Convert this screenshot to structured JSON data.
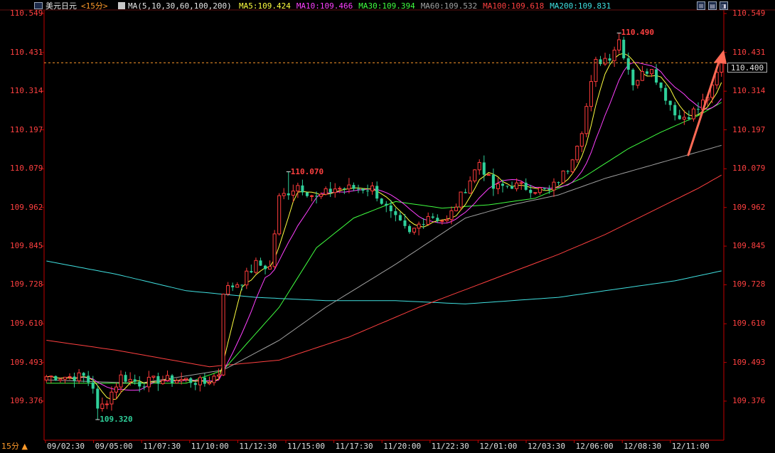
{
  "header": {
    "symbol": "美元日元",
    "period_tag": "<15分>",
    "ma_params": "MA(5,10,30,60,100,200)",
    "ma_items": [
      {
        "label": "MA5:109.424",
        "color": "#ffff40"
      },
      {
        "label": "MA10:109.466",
        "color": "#ff40ff"
      },
      {
        "label": "MA30:109.394",
        "color": "#40ff40"
      },
      {
        "label": "MA60:109.532",
        "color": "#a0a0a0"
      },
      {
        "label": "MA100:109.618",
        "color": "#ff4040"
      },
      {
        "label": "MA200:109.831",
        "color": "#40e0e0"
      }
    ]
  },
  "toolbar": {
    "buttons": [
      {
        "name": "layout-icon",
        "glyph": "⊞"
      },
      {
        "name": "chart-mode-icon",
        "glyph": "▤"
      },
      {
        "name": "window-icon",
        "glyph": "◨"
      }
    ]
  },
  "footer": {
    "period_label": "15分 ▲"
  },
  "current_price": "110.400",
  "colors": {
    "up": "#ff3c3c",
    "down": "#2fd09a",
    "grid": "#7a2020",
    "axis_text": "#ff4040",
    "arrow": "#ff6a55",
    "current_line": "#ff9a2a"
  },
  "chart_data": {
    "type": "candlestick",
    "y_ticks": [
      "110.549",
      "110.431",
      "110.314",
      "110.197",
      "110.079",
      "109.962",
      "109.845",
      "109.728",
      "109.610",
      "109.493",
      "109.376"
    ],
    "ylim": [
      109.32,
      110.55
    ],
    "x_tick_labels": [
      "09/02:30",
      "09/05:00",
      "11/07:30",
      "11/10:00",
      "11/12:30",
      "11/15:00",
      "11/17:30",
      "11/20:00",
      "11/22:30",
      "12/01:00",
      "12/03:30",
      "12/06:00",
      "12/08:30",
      "12/11:00"
    ],
    "annotations": [
      {
        "text": "110.070",
        "value": 110.07,
        "bar_index": 52,
        "color": "#ff4040"
      },
      {
        "text": "110.490",
        "value": 110.49,
        "bar_index": 123,
        "color": "#ff4040"
      },
      {
        "text": "109.320",
        "value": 109.32,
        "bar_index": 11,
        "color": "#2fd09a"
      }
    ],
    "anchors": [
      [
        0,
        109.45
      ],
      [
        8,
        109.45
      ],
      [
        10,
        109.42
      ],
      [
        11,
        109.345
      ],
      [
        13,
        109.38
      ],
      [
        16,
        109.45
      ],
      [
        20,
        109.43
      ],
      [
        24,
        109.44
      ],
      [
        30,
        109.44
      ],
      [
        34,
        109.43
      ],
      [
        37,
        109.46
      ],
      [
        38,
        109.71
      ],
      [
        42,
        109.74
      ],
      [
        45,
        109.79
      ],
      [
        48,
        109.78
      ],
      [
        50,
        109.99
      ],
      [
        54,
        110.03
      ],
      [
        58,
        109.99
      ],
      [
        62,
        110.02
      ],
      [
        66,
        110.02
      ],
      [
        70,
        110.02
      ],
      [
        74,
        109.94
      ],
      [
        78,
        109.88
      ],
      [
        82,
        109.94
      ],
      [
        86,
        109.92
      ],
      [
        90,
        110.02
      ],
      [
        93,
        110.1
      ],
      [
        96,
        110.02
      ],
      [
        100,
        110.03
      ],
      [
        104,
        110.02
      ],
      [
        108,
        110.01
      ],
      [
        112,
        110.08
      ],
      [
        115,
        110.2
      ],
      [
        118,
        110.4
      ],
      [
        121,
        110.42
      ],
      [
        123,
        110.47
      ],
      [
        126,
        110.34
      ],
      [
        130,
        110.39
      ],
      [
        132,
        110.32
      ],
      [
        136,
        110.23
      ],
      [
        140,
        110.26
      ],
      [
        143,
        110.32
      ],
      [
        145,
        110.41
      ]
    ],
    "ma_curves": {
      "MA200": [
        [
          0,
          109.8
        ],
        [
          15,
          109.76
        ],
        [
          30,
          109.71
        ],
        [
          45,
          109.69
        ],
        [
          60,
          109.68
        ],
        [
          75,
          109.68
        ],
        [
          90,
          109.67
        ],
        [
          100,
          109.68
        ],
        [
          110,
          109.69
        ],
        [
          120,
          109.71
        ],
        [
          135,
          109.74
        ],
        [
          145,
          109.77
        ]
      ],
      "MA100": [
        [
          0,
          109.56
        ],
        [
          15,
          109.53
        ],
        [
          35,
          109.48
        ],
        [
          50,
          109.5
        ],
        [
          65,
          109.57
        ],
        [
          80,
          109.66
        ],
        [
          95,
          109.74
        ],
        [
          110,
          109.82
        ],
        [
          120,
          109.88
        ],
        [
          130,
          109.95
        ],
        [
          140,
          110.02
        ],
        [
          145,
          110.06
        ]
      ],
      "MA60": [
        [
          0,
          109.44
        ],
        [
          20,
          109.43
        ],
        [
          38,
          109.47
        ],
        [
          50,
          109.56
        ],
        [
          60,
          109.66
        ],
        [
          75,
          109.79
        ],
        [
          90,
          109.93
        ],
        [
          100,
          109.97
        ],
        [
          110,
          110.0
        ],
        [
          120,
          110.05
        ],
        [
          135,
          110.11
        ],
        [
          145,
          110.15
        ]
      ],
      "MA30": [
        [
          0,
          109.43
        ],
        [
          30,
          109.43
        ],
        [
          38,
          109.47
        ],
        [
          50,
          109.66
        ],
        [
          58,
          109.84
        ],
        [
          66,
          109.93
        ],
        [
          75,
          109.98
        ],
        [
          85,
          109.96
        ],
        [
          95,
          109.97
        ],
        [
          105,
          109.99
        ],
        [
          115,
          110.05
        ],
        [
          125,
          110.14
        ],
        [
          132,
          110.19
        ],
        [
          140,
          110.24
        ],
        [
          145,
          110.28
        ]
      ]
    }
  }
}
